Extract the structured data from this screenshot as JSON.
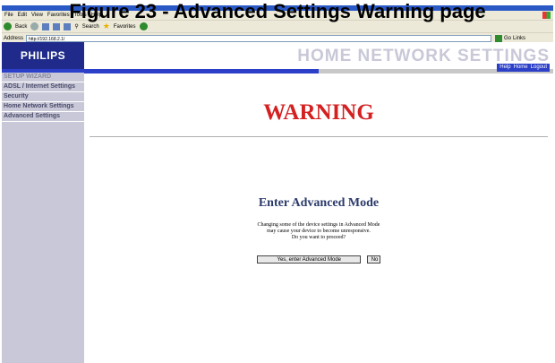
{
  "caption": "Figure 23 - Advanced Settings Warning page",
  "browser": {
    "menu": [
      "File",
      "Edit",
      "View",
      "Favorites",
      "Tools",
      "Help"
    ],
    "toolbar": {
      "back": "Back",
      "search": "Search",
      "favorites": "Favorites"
    },
    "address_label": "Address",
    "address_value": "http://192.168.2.1/",
    "go_label": "Go",
    "links_label": "Links"
  },
  "header": {
    "logo": "PHILIPS",
    "title": "HOME NETWORK SETTINGS",
    "links": {
      "help": "Help",
      "home": "Home",
      "logout": "Logout"
    }
  },
  "sidebar": {
    "items": [
      {
        "label": "SETUP WIZARD"
      },
      {
        "label": "ADSL / Internet Settings"
      },
      {
        "label": "Security"
      },
      {
        "label": "Home Network Settings"
      },
      {
        "label": "Advanced Settings"
      }
    ]
  },
  "main": {
    "warning": "WARNING",
    "section_title": "Enter Advanced Mode",
    "message_line1": "Changing some of the device settings in Advanced Mode",
    "message_line2": "may cause your device to become unresponsive.",
    "message_line3": "Do you want to proceed?",
    "yes_label": "Yes, enter Advanced Mode",
    "no_label": "No"
  },
  "colors": {
    "brand": "#1f2a8a",
    "stripe": "#2b3fc8",
    "warning": "#d42020",
    "sidebar_bg": "#c8c8d8"
  }
}
